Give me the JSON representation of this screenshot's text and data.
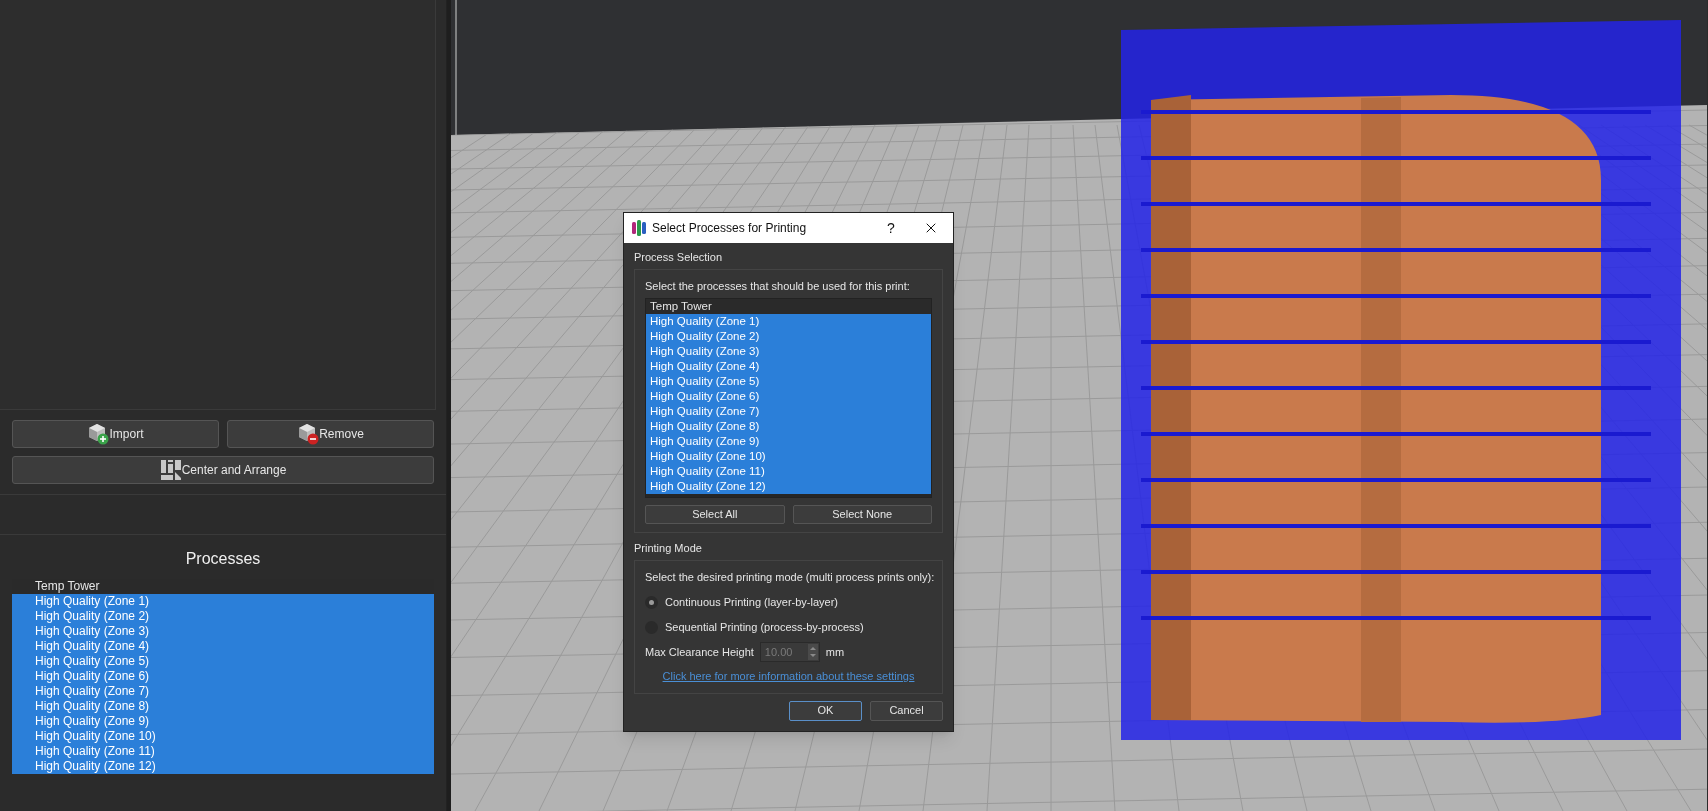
{
  "left_panel": {
    "buttons": [
      {
        "label": "Import",
        "kind": "import"
      },
      {
        "label": "Remove",
        "kind": "remove"
      },
      {
        "label": "Center and Arrange",
        "kind": "arrange"
      }
    ],
    "processes": {
      "title": "Processes",
      "items": [
        {
          "label": "Temp Tower",
          "selected": false
        },
        {
          "label": "High Quality (Zone 1)",
          "selected": true
        },
        {
          "label": "High Quality (Zone 2)",
          "selected": true
        },
        {
          "label": "High Quality (Zone 3)",
          "selected": true
        },
        {
          "label": "High Quality (Zone 4)",
          "selected": true
        },
        {
          "label": "High Quality (Zone 5)",
          "selected": true
        },
        {
          "label": "High Quality (Zone 6)",
          "selected": true
        },
        {
          "label": "High Quality (Zone 7)",
          "selected": true
        },
        {
          "label": "High Quality (Zone 8)",
          "selected": true
        },
        {
          "label": "High Quality (Zone 9)",
          "selected": true
        },
        {
          "label": "High Quality (Zone 10)",
          "selected": true
        },
        {
          "label": "High Quality (Zone 11)",
          "selected": true
        },
        {
          "label": "High Quality (Zone 12)",
          "selected": true
        }
      ]
    }
  },
  "dialog": {
    "title": "Select Processes for Printing",
    "help": "?",
    "process_selection": {
      "heading": "Process Selection",
      "instruction": "Select the processes that should be used for this print:",
      "items": [
        {
          "label": "Temp Tower",
          "selected": false
        },
        {
          "label": "High Quality (Zone 1)",
          "selected": true
        },
        {
          "label": "High Quality (Zone 2)",
          "selected": true
        },
        {
          "label": "High Quality (Zone 3)",
          "selected": true
        },
        {
          "label": "High Quality (Zone 4)",
          "selected": true
        },
        {
          "label": "High Quality (Zone 5)",
          "selected": true
        },
        {
          "label": "High Quality (Zone 6)",
          "selected": true
        },
        {
          "label": "High Quality (Zone 7)",
          "selected": true
        },
        {
          "label": "High Quality (Zone 8)",
          "selected": true
        },
        {
          "label": "High Quality (Zone 9)",
          "selected": true
        },
        {
          "label": "High Quality (Zone 10)",
          "selected": true
        },
        {
          "label": "High Quality (Zone 11)",
          "selected": true
        },
        {
          "label": "High Quality (Zone 12)",
          "selected": true
        }
      ],
      "buttons": [
        "Select All",
        "Select None"
      ]
    },
    "printing_mode": {
      "heading": "Printing Mode",
      "instruction": "Select the desired printing mode (multi process prints only):",
      "options": [
        {
          "label": "Continuous Printing (layer-by-layer)",
          "selected": true
        },
        {
          "label": "Sequential Printing (process-by-process)",
          "selected": false
        }
      ],
      "clearance": {
        "label": "Max Clearance Height",
        "value": "10.00",
        "unit": "mm",
        "disabled": true
      },
      "link": "Click here for more information about these settings"
    },
    "buttons": [
      {
        "label": "OK",
        "default": true
      },
      {
        "label": "Cancel",
        "default": false
      }
    ]
  }
}
